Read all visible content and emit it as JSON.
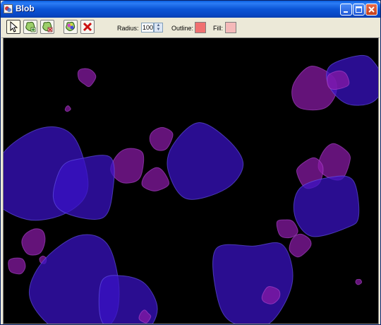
{
  "window": {
    "title": "Blob"
  },
  "toolbar": {
    "tools": [
      {
        "icon": "cursor-icon",
        "active": true
      },
      {
        "icon": "add-blob-icon",
        "active": false
      },
      {
        "icon": "remove-blob-icon",
        "active": false
      },
      {
        "icon": "paint-blob-icon",
        "active": false
      },
      {
        "icon": "delete-x-icon",
        "active": false
      }
    ],
    "radius_label": "Radius:",
    "radius_value": "100",
    "outline_label": "Outline:",
    "outline_color": "#f07070",
    "fill_label": "Fill:",
    "fill_color": "#f5b9b9"
  },
  "canvas": {
    "background": "#000000",
    "blob_colors": {
      "purple": "#8a1aa8",
      "blue": "#3a12c8"
    },
    "blob_count": 27
  }
}
